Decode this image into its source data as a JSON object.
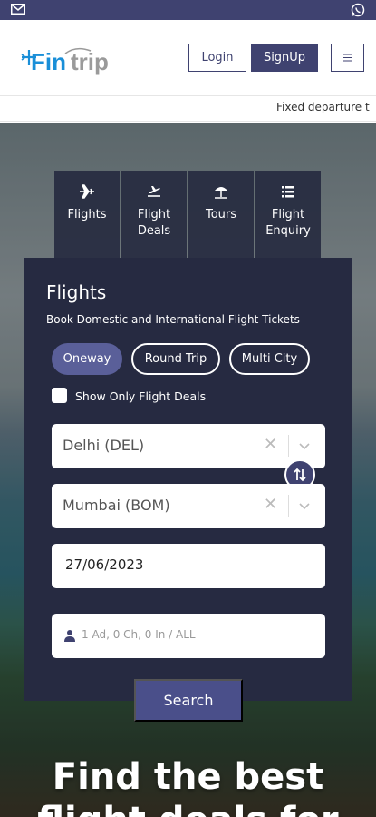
{
  "topbar": {
    "left_icon": "mail-icon",
    "right_icon": "whatsapp-icon"
  },
  "header": {
    "logo_text": "Fintrip",
    "login_label": "Login",
    "signup_label": "SignUp",
    "menu_icon": "hamburger-icon"
  },
  "ticker": {
    "text": "Fixed departure t"
  },
  "tabs": [
    {
      "label": "Flights",
      "icon": "airplane-icon"
    },
    {
      "label": "Flight Deals",
      "icon": "plane-takeoff-icon"
    },
    {
      "label": "Tours",
      "icon": "beach-umbrella-icon"
    },
    {
      "label": "Flight Enquiry",
      "icon": "list-icon"
    }
  ],
  "panel": {
    "title": "Flights",
    "subtitle": "Book Domestic and International Flight Tickets",
    "trip_types": [
      "Oneway",
      "Round Trip",
      "Multi City"
    ],
    "selected_trip": "Oneway",
    "deals_checkbox_label": "Show Only Flight Deals",
    "from_value": "Delhi (DEL)",
    "to_value": "Mumbai (BOM)",
    "date_value": "27/06/2023",
    "pax_placeholder": "1 Ad, 0 Ch, 0 In / ALL",
    "search_label": "Search"
  },
  "hero": {
    "headline": "Find the best flight deals for"
  },
  "colors": {
    "primary": "#3f4270",
    "panel": "#262a41",
    "accent": "#5a5f99"
  }
}
